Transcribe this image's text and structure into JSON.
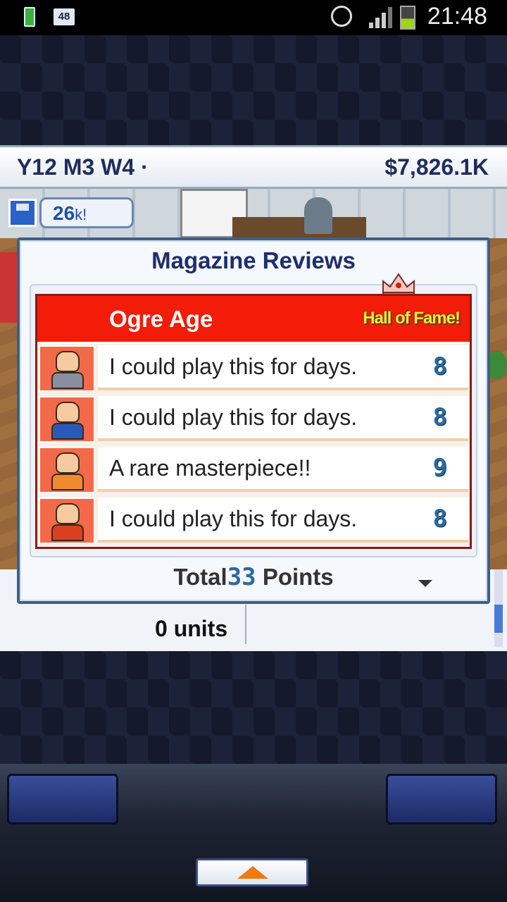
{
  "status_bar": {
    "notification_count": "48",
    "time": "21:48",
    "icons": [
      "battery-small-icon",
      "notification-badge",
      "alarm-icon",
      "signal-icon",
      "battery-icon"
    ]
  },
  "info_bar": {
    "date": "Y12 M3 W4 ·",
    "money": "$7,826.1K"
  },
  "hud": {
    "fans": "26",
    "fans_suffix": "k!"
  },
  "dialog": {
    "title": "Magazine Reviews",
    "game_name": "Ogre Age",
    "award": "Hall of Fame!",
    "reviews": [
      {
        "comment": "I could play this for days.",
        "score": "8",
        "reviewer_color": "#8a8fa0"
      },
      {
        "comment": "I could play this for days.",
        "score": "8",
        "reviewer_color": "#2a5ab8"
      },
      {
        "comment": "A rare masterpiece!!",
        "score": "9",
        "reviewer_color": "#f08a30"
      },
      {
        "comment": "I could play this for days.",
        "score": "8",
        "reviewer_color": "#d84020"
      }
    ],
    "total_label": "Total",
    "total_value": "33",
    "total_suffix": "Points"
  },
  "lower_panel": {
    "units": "0 units"
  },
  "colors": {
    "header_red": "#f21c08",
    "award_yellow": "#f7e63a",
    "title_navy": "#1e2d6e",
    "score_blue": "#2a6aa0"
  }
}
